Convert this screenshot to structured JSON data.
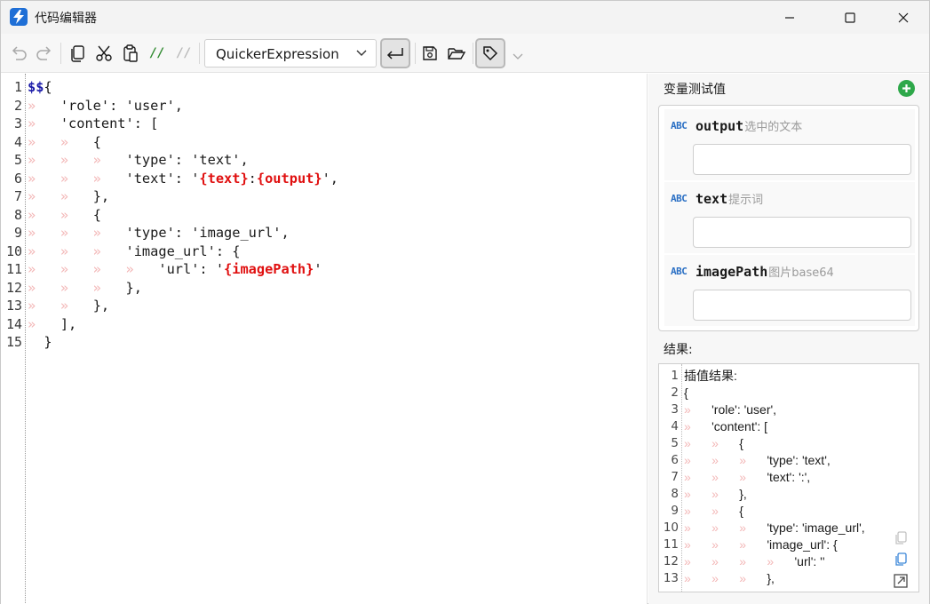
{
  "window": {
    "title": "代码编辑器"
  },
  "toolbar": {
    "comment_label": "//",
    "uncomment_label": "//",
    "mode_value": "QuickerExpression"
  },
  "editor": {
    "line_numbers": [
      "1",
      "2",
      "3",
      "4",
      "5",
      "6",
      "7",
      "8",
      "9",
      "10",
      "11",
      "12",
      "13",
      "14",
      "15"
    ],
    "lines": [
      {
        "ind": "",
        "parts": [
          {
            "t": "$$",
            "c": "dol"
          },
          {
            "t": "{",
            "c": ""
          }
        ]
      },
      {
        "ind": "»   ",
        "parts": [
          {
            "t": "'role': 'user',",
            "c": ""
          }
        ]
      },
      {
        "ind": "»   ",
        "parts": [
          {
            "t": "'content': [",
            "c": ""
          }
        ]
      },
      {
        "ind": "»   »   ",
        "parts": [
          {
            "t": "{",
            "c": ""
          }
        ]
      },
      {
        "ind": "»   »   »   ",
        "parts": [
          {
            "t": "'type': 'text',",
            "c": ""
          }
        ]
      },
      {
        "ind": "»   »   »   ",
        "parts": [
          {
            "t": "'text': '",
            "c": ""
          },
          {
            "t": "{text}",
            "c": "var"
          },
          {
            "t": ":",
            "c": ""
          },
          {
            "t": "{output}",
            "c": "var"
          },
          {
            "t": "',",
            "c": ""
          }
        ]
      },
      {
        "ind": "»   »   ",
        "parts": [
          {
            "t": "},",
            "c": ""
          }
        ]
      },
      {
        "ind": "»   »   ",
        "parts": [
          {
            "t": "{",
            "c": ""
          }
        ]
      },
      {
        "ind": "»   »   »   ",
        "parts": [
          {
            "t": "'type': 'image_url',",
            "c": ""
          }
        ]
      },
      {
        "ind": "»   »   »   ",
        "parts": [
          {
            "t": "'image_url': {",
            "c": ""
          }
        ]
      },
      {
        "ind": "»   »   »   »   ",
        "parts": [
          {
            "t": "'url': '",
            "c": ""
          },
          {
            "t": "{imagePath}",
            "c": "var"
          },
          {
            "t": "'",
            "c": ""
          }
        ]
      },
      {
        "ind": "»   »   »   ",
        "parts": [
          {
            "t": "},",
            "c": ""
          }
        ]
      },
      {
        "ind": "»   »   ",
        "parts": [
          {
            "t": "},",
            "c": ""
          }
        ]
      },
      {
        "ind": "»   ",
        "parts": [
          {
            "t": "],",
            "c": ""
          }
        ]
      },
      {
        "ind": "  ",
        "parts": [
          {
            "t": "}",
            "c": ""
          }
        ]
      }
    ]
  },
  "panel": {
    "title": "变量测试值",
    "variables": [
      {
        "type": "ABC",
        "name": "output",
        "hint": "选中的文本",
        "value": ""
      },
      {
        "type": "ABC",
        "name": "text",
        "hint": "提示词",
        "value": ""
      },
      {
        "type": "ABC",
        "name": "imagePath",
        "hint": "图片base64",
        "value": ""
      }
    ],
    "result_title": "结果:",
    "result_line_numbers": [
      "1",
      "2",
      "3",
      "4",
      "5",
      "6",
      "7",
      "8",
      "9",
      "10",
      "11",
      "12",
      "13"
    ],
    "result_lines": [
      {
        "ind": "",
        "text": "插值结果:"
      },
      {
        "ind": "",
        "text": "{"
      },
      {
        "ind": "»      ",
        "text": "'role': 'user',"
      },
      {
        "ind": "»      ",
        "text": "'content': ["
      },
      {
        "ind": "»      »      ",
        "text": "{"
      },
      {
        "ind": "»      »      »      ",
        "text": "'type': 'text',"
      },
      {
        "ind": "»      »      »      ",
        "text": "'text': ':',"
      },
      {
        "ind": "»      »      ",
        "text": "},"
      },
      {
        "ind": "»      »      ",
        "text": "{"
      },
      {
        "ind": "»      »      »      ",
        "text": "'type': 'image_url',"
      },
      {
        "ind": "»      »      »      ",
        "text": "'image_url': {"
      },
      {
        "ind": "»      »      »      »      ",
        "text": "'url': ''"
      },
      {
        "ind": "»      »      »      ",
        "text": "},"
      }
    ]
  },
  "icons": {
    "app": "lightning-app-icon",
    "undo": "undo-icon",
    "redo": "redo-icon",
    "copy": "copy-icon",
    "cut": "scissors-icon",
    "paste": "paste-icon",
    "wrap": "word-wrap-icon",
    "save": "save-icon",
    "open": "folder-open-icon",
    "tag": "tag-icon",
    "add": "plus-circle-icon"
  },
  "colors": {
    "accent_blue": "#1f6fd6",
    "variable_red": "#e01010",
    "dollar_blue": "#1a1aa8",
    "indent_guide": "#f3b7b7",
    "add_green": "#2ea84a"
  }
}
